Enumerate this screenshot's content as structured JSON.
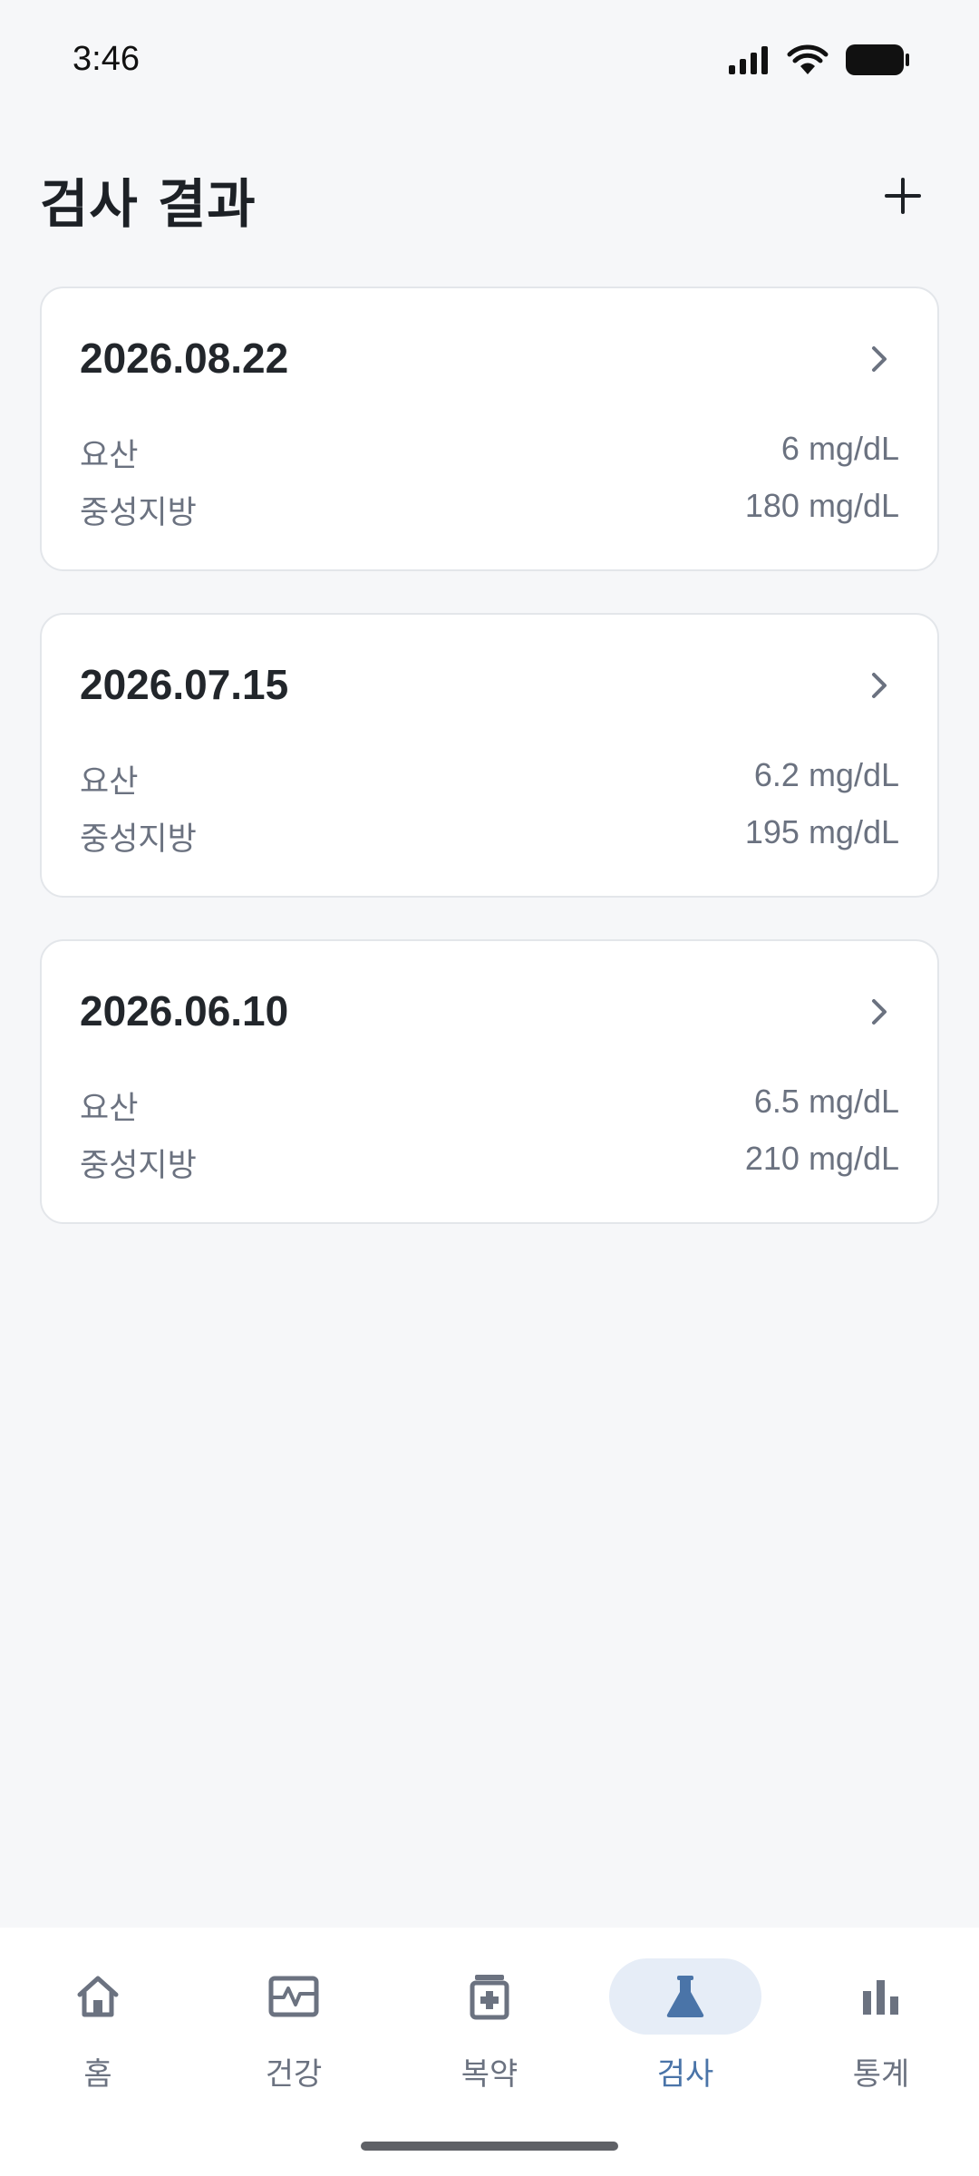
{
  "status_bar": {
    "time": "3:46"
  },
  "header": {
    "title": "검사 결과",
    "add_icon": "plus-icon"
  },
  "results": [
    {
      "date": "2026.08.22",
      "items": [
        {
          "label": "요산",
          "value": "6 mg/dL"
        },
        {
          "label": "중성지방",
          "value": "180 mg/dL"
        }
      ]
    },
    {
      "date": "2026.07.15",
      "items": [
        {
          "label": "요산",
          "value": "6.2 mg/dL"
        },
        {
          "label": "중성지방",
          "value": "195 mg/dL"
        }
      ]
    },
    {
      "date": "2026.06.10",
      "items": [
        {
          "label": "요산",
          "value": "6.5 mg/dL"
        },
        {
          "label": "중성지방",
          "value": "210 mg/dL"
        }
      ]
    }
  ],
  "nav": {
    "items": [
      {
        "label": "홈",
        "icon": "home-icon"
      },
      {
        "label": "건강",
        "icon": "pulse-icon"
      },
      {
        "label": "복약",
        "icon": "medicine-icon"
      },
      {
        "label": "검사",
        "icon": "flask-icon"
      },
      {
        "label": "통계",
        "icon": "chart-icon"
      }
    ],
    "active_index": 3
  },
  "colors": {
    "background": "#f6f7f9",
    "accent": "#4a74a8",
    "accent_bg": "#e6edf7",
    "muted_text": "#6b7280"
  }
}
